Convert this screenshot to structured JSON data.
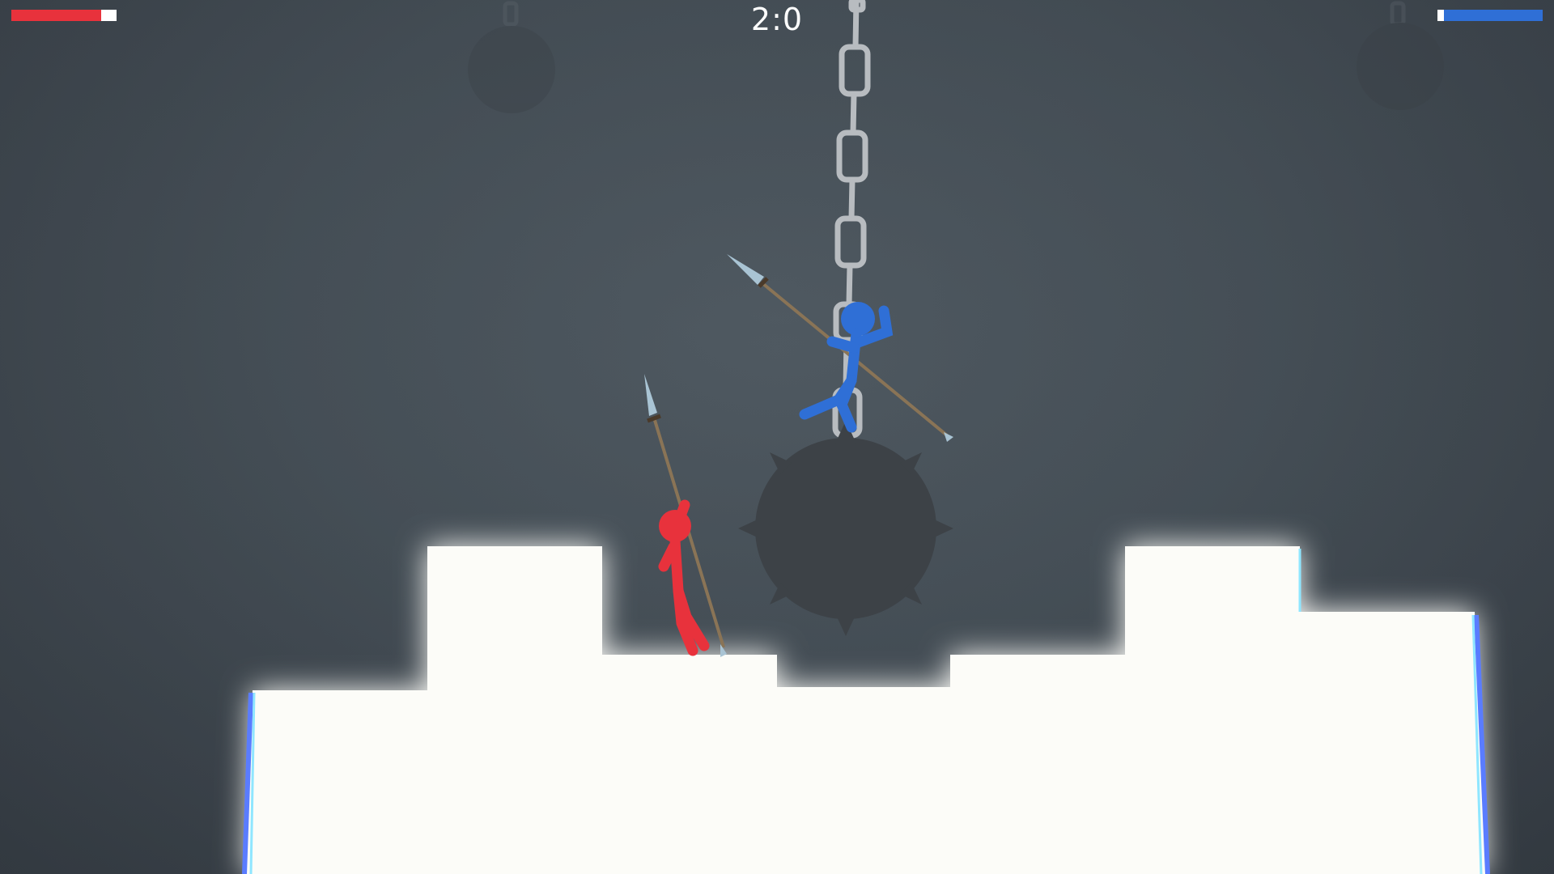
{
  "hud": {
    "score": "2:0",
    "player1": {
      "team": "red",
      "color": "#e8323c",
      "health": 0.85
    },
    "player2": {
      "team": "blue",
      "color": "#2f6fd6",
      "health": 0.94
    }
  },
  "scene": {
    "background_color": "#465058",
    "platform_color": "#fcfcf8",
    "wrecking_ball_color": "#3d4247",
    "chain_color": "#b8bcc0",
    "spear_shaft_color": "#8a7456",
    "spear_tip_color": "#a9c4d4",
    "icons": [
      "chain-icon",
      "wrecking-ball-icon",
      "spear-icon",
      "stickman-icon"
    ]
  }
}
